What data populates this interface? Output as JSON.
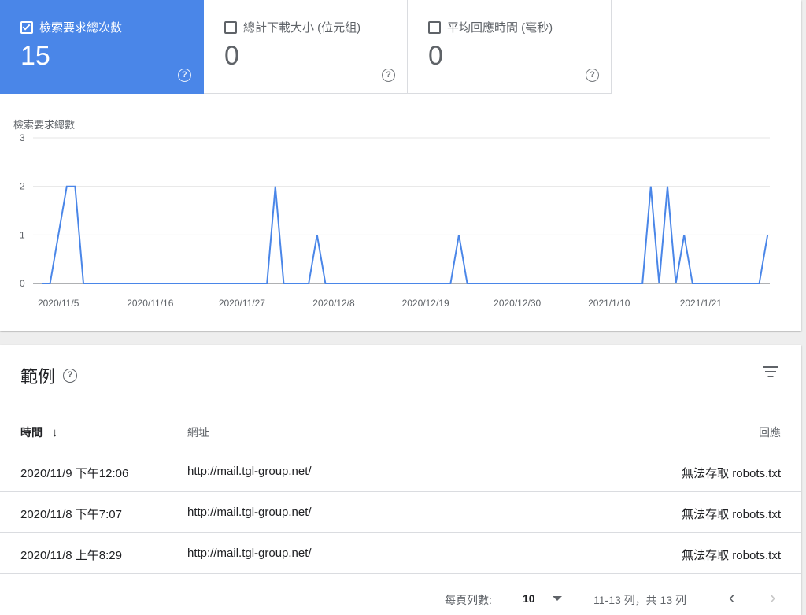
{
  "metrics": [
    {
      "label": "檢索要求總次數",
      "value": "15",
      "active": true
    },
    {
      "label": "總計下載大小 (位元組)",
      "value": "0",
      "active": false
    },
    {
      "label": "平均回應時間 (毫秒)",
      "value": "0",
      "active": false
    }
  ],
  "help_glyph": "?",
  "chart_data": {
    "type": "line",
    "title": "檢索要求總數",
    "ylim": [
      0,
      3
    ],
    "yticks": [
      "0",
      "1",
      "2",
      "3"
    ],
    "xtick_labels": [
      "2020/11/5",
      "2020/11/16",
      "2020/11/27",
      "2020/12/8",
      "2020/12/19",
      "2020/12/30",
      "2021/1/10",
      "2021/1/21"
    ],
    "x_start": "2020/11/3",
    "series": [
      {
        "color": "#4a86e8",
        "values": [
          0,
          0,
          1,
          2,
          2,
          0,
          0,
          0,
          0,
          0,
          0,
          0,
          0,
          0,
          0,
          0,
          0,
          0,
          0,
          0,
          0,
          0,
          0,
          0,
          0,
          0,
          0,
          0,
          0,
          0,
          0,
          0,
          0,
          0,
          0,
          0,
          0,
          0,
          0,
          0,
          0,
          0,
          0,
          0,
          0,
          0,
          0,
          0,
          0,
          0,
          0,
          0,
          0,
          0,
          0,
          0,
          0,
          0,
          0,
          0,
          0,
          0,
          0,
          0,
          0,
          0,
          0,
          0,
          0,
          0,
          0,
          0,
          0,
          0,
          0,
          0,
          0,
          0,
          0,
          0,
          0,
          0,
          0,
          0,
          0,
          0,
          0,
          0
        ]
      }
    ],
    "points": [
      [
        "2020/11/3",
        0
      ],
      [
        "2020/11/4",
        0
      ],
      [
        "2020/11/5",
        1
      ],
      [
        "2020/11/6",
        2
      ],
      [
        "2020/11/7",
        2
      ],
      [
        "2020/11/8",
        0
      ],
      [
        "2020/11/30",
        0
      ],
      [
        "2020/12/1",
        2
      ],
      [
        "2020/12/2",
        0
      ],
      [
        "2020/12/5",
        0
      ],
      [
        "2020/12/6",
        1
      ],
      [
        "2020/12/7",
        0
      ],
      [
        "2020/12/22",
        0
      ],
      [
        "2020/12/23",
        1
      ],
      [
        "2020/12/24",
        0
      ],
      [
        "2021/1/14",
        0
      ],
      [
        "2021/1/15",
        2
      ],
      [
        "2021/1/16",
        0
      ],
      [
        "2021/1/17",
        2
      ],
      [
        "2021/1/18",
        0
      ],
      [
        "2021/1/19",
        1
      ],
      [
        "2021/1/20",
        0
      ],
      [
        "2021/1/28",
        0
      ],
      [
        "2021/1/29",
        1
      ]
    ],
    "grid": true
  },
  "examples": {
    "title": "範例",
    "columns": {
      "time": "時間",
      "url": "網址",
      "response": "回應"
    },
    "sort_arrow": "↓",
    "rows": [
      {
        "time": "2020/11/9 下午12:06",
        "url": "http://mail.tgl-group.net/",
        "response": "無法存取 robots.txt"
      },
      {
        "time": "2020/11/8 下午7:07",
        "url": "http://mail.tgl-group.net/",
        "response": "無法存取 robots.txt"
      },
      {
        "time": "2020/11/8 上午8:29",
        "url": "http://mail.tgl-group.net/",
        "response": "無法存取 robots.txt"
      }
    ]
  },
  "pager": {
    "rows_per_page_label": "每頁列數:",
    "rows_per_page_value": "10",
    "range": "11-13 列，共 13 列",
    "prev": "‹",
    "next": "›"
  }
}
